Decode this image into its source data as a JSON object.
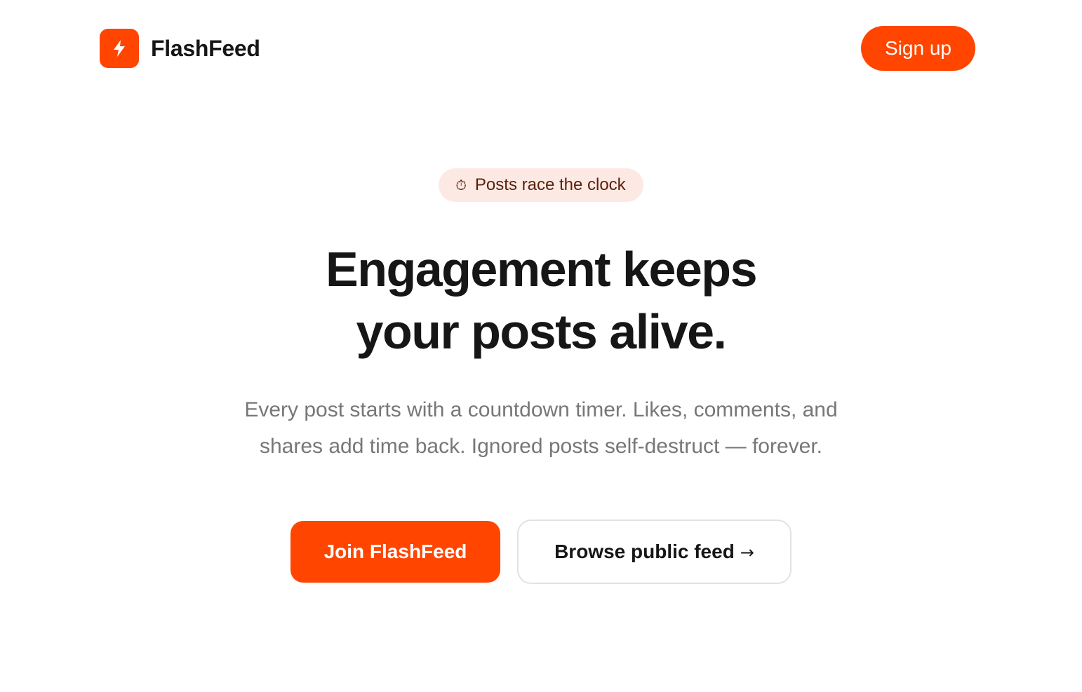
{
  "colors": {
    "accent": "#ff4500",
    "badge_bg": "#fde9e4",
    "badge_text": "#5b2109",
    "heading": "#161616",
    "body_text": "#777777",
    "border": "#e2e2e2"
  },
  "header": {
    "logo_icon": "lightning-bolt-icon",
    "brand_name": "FlashFeed",
    "signup_label": "Sign up"
  },
  "hero": {
    "badge": {
      "icon": "stopwatch-icon",
      "icon_glyph": "⏱",
      "text": "Posts race the clock"
    },
    "title_lines": [
      "Engagement keeps",
      "your posts alive."
    ],
    "subtitle": "Every post starts with a countdown timer. Likes, comments, and shares add time back. Ignored posts self-destruct — forever.",
    "primary_cta": "Join FlashFeed",
    "secondary_cta": "Browse public feed",
    "secondary_cta_arrow": "→"
  }
}
